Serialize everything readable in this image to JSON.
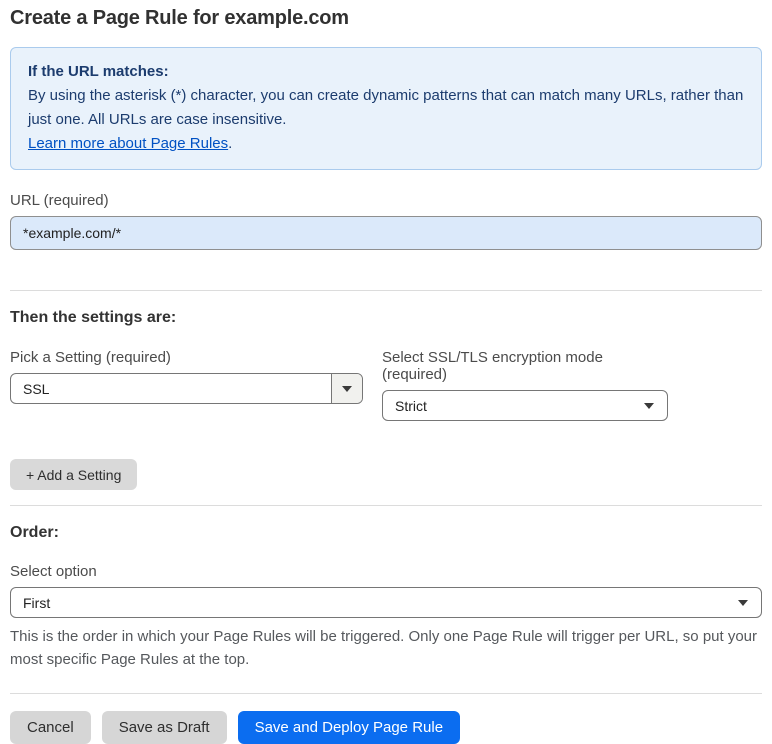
{
  "page": {
    "title": "Create a Page Rule for example.com"
  },
  "info_box": {
    "heading": "If the URL matches:",
    "body": "By using the asterisk (*) character, you can create dynamic patterns that can match many URLs, rather than just one. All URLs are case insensitive.",
    "link_label": "Learn more about Page Rules",
    "link_suffix": "."
  },
  "url_field": {
    "label": "URL (required)",
    "value": "*example.com/*"
  },
  "settings_section": {
    "heading": "Then the settings are:",
    "setting_picker": {
      "label": "Pick a Setting (required)",
      "value": "SSL"
    },
    "mode_picker": {
      "label": "Select SSL/TLS encryption mode (required)",
      "value": "Strict"
    },
    "add_setting_label": "+ Add a Setting"
  },
  "order_section": {
    "heading": "Order:",
    "label": "Select option",
    "value": "First",
    "help_text": "This is the order in which your Page Rules will be triggered. Only one Page Rule will trigger per URL, so put your most specific Page Rules at the top."
  },
  "footer": {
    "cancel_label": "Cancel",
    "save_draft_label": "Save as Draft",
    "save_deploy_label": "Save and Deploy Page Rule"
  },
  "colors": {
    "accent_blue": "#0b6df0",
    "link_blue": "#0051c3",
    "info_background": "#e9f2fb",
    "info_border": "#aacbed",
    "info_text": "#1c3c6e",
    "input_background": "#dbe9fa"
  }
}
